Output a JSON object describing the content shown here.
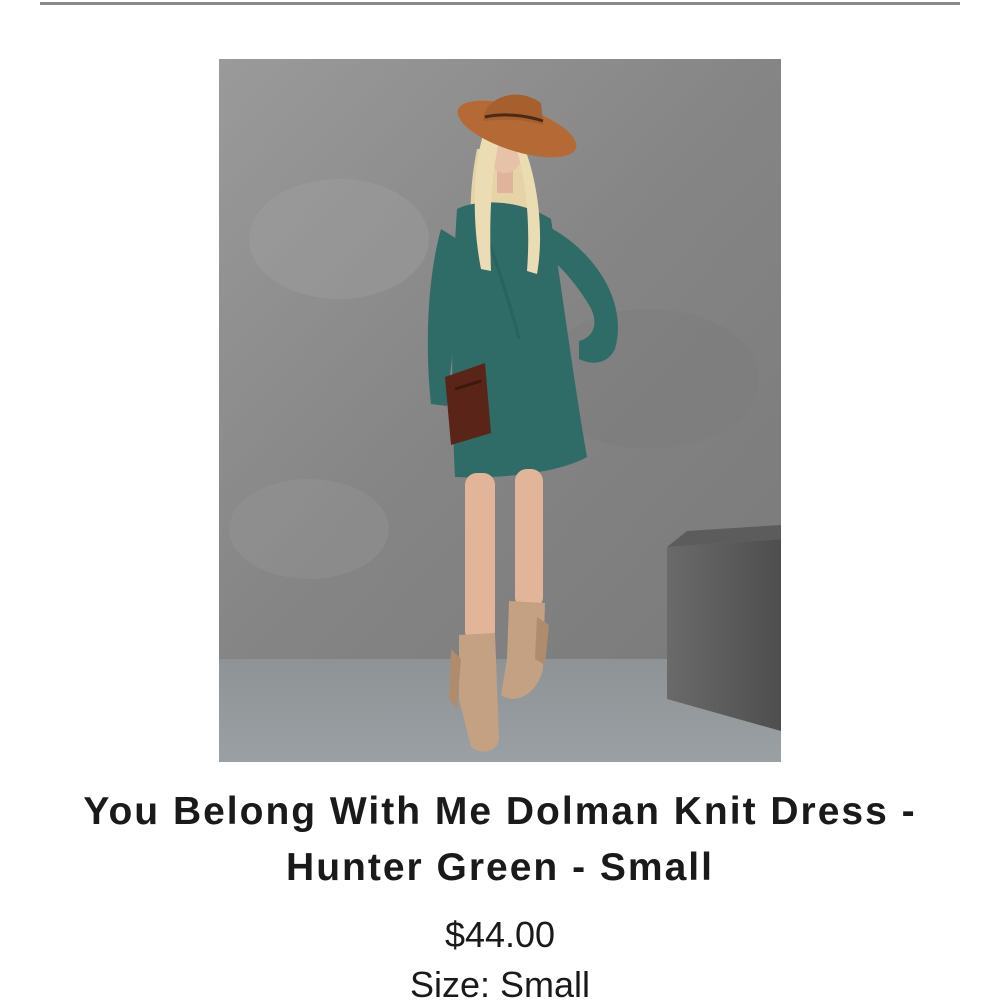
{
  "product": {
    "image_icon": "product-photo-icon",
    "title": "You Belong With Me Dolman Knit Dress - Hunter Green - Small",
    "price": "$44.00",
    "size_line": "Size: Small"
  },
  "colors": {
    "divider": "#8a8a8a",
    "text": "#1a1a1a",
    "background": "#ffffff",
    "dress": "#2f6b67",
    "hat": "#b56a35",
    "bag": "#5a2418",
    "boots": "#c4a182",
    "wall": "#8c8c8c"
  }
}
